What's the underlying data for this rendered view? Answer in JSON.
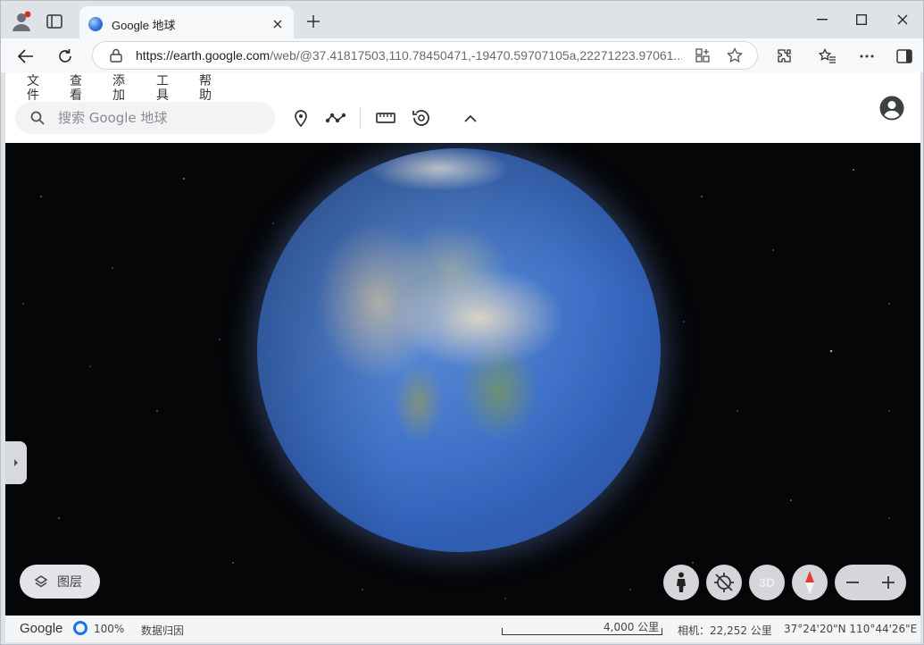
{
  "browser": {
    "tab_title": "Google 地球",
    "url_host": "https://earth.google.com",
    "url_path": "/web/@37.41817503,110.78450471,-19470.59707105a,22271223.97061..."
  },
  "menu": [
    "文件",
    "查看",
    "添加",
    "工具",
    "帮助"
  ],
  "search": {
    "placeholder": "搜索 Google 地球"
  },
  "map_controls": {
    "layers_label": "图层",
    "btn_3d": "3D"
  },
  "status": {
    "brand": "Google",
    "load_percent": "100%",
    "data_attribution": "数据归因",
    "scale_label": "4,000 公里",
    "camera": "相机：22,252 公里",
    "coordinates": "37°24'20\"N 110°44'26\"E"
  }
}
